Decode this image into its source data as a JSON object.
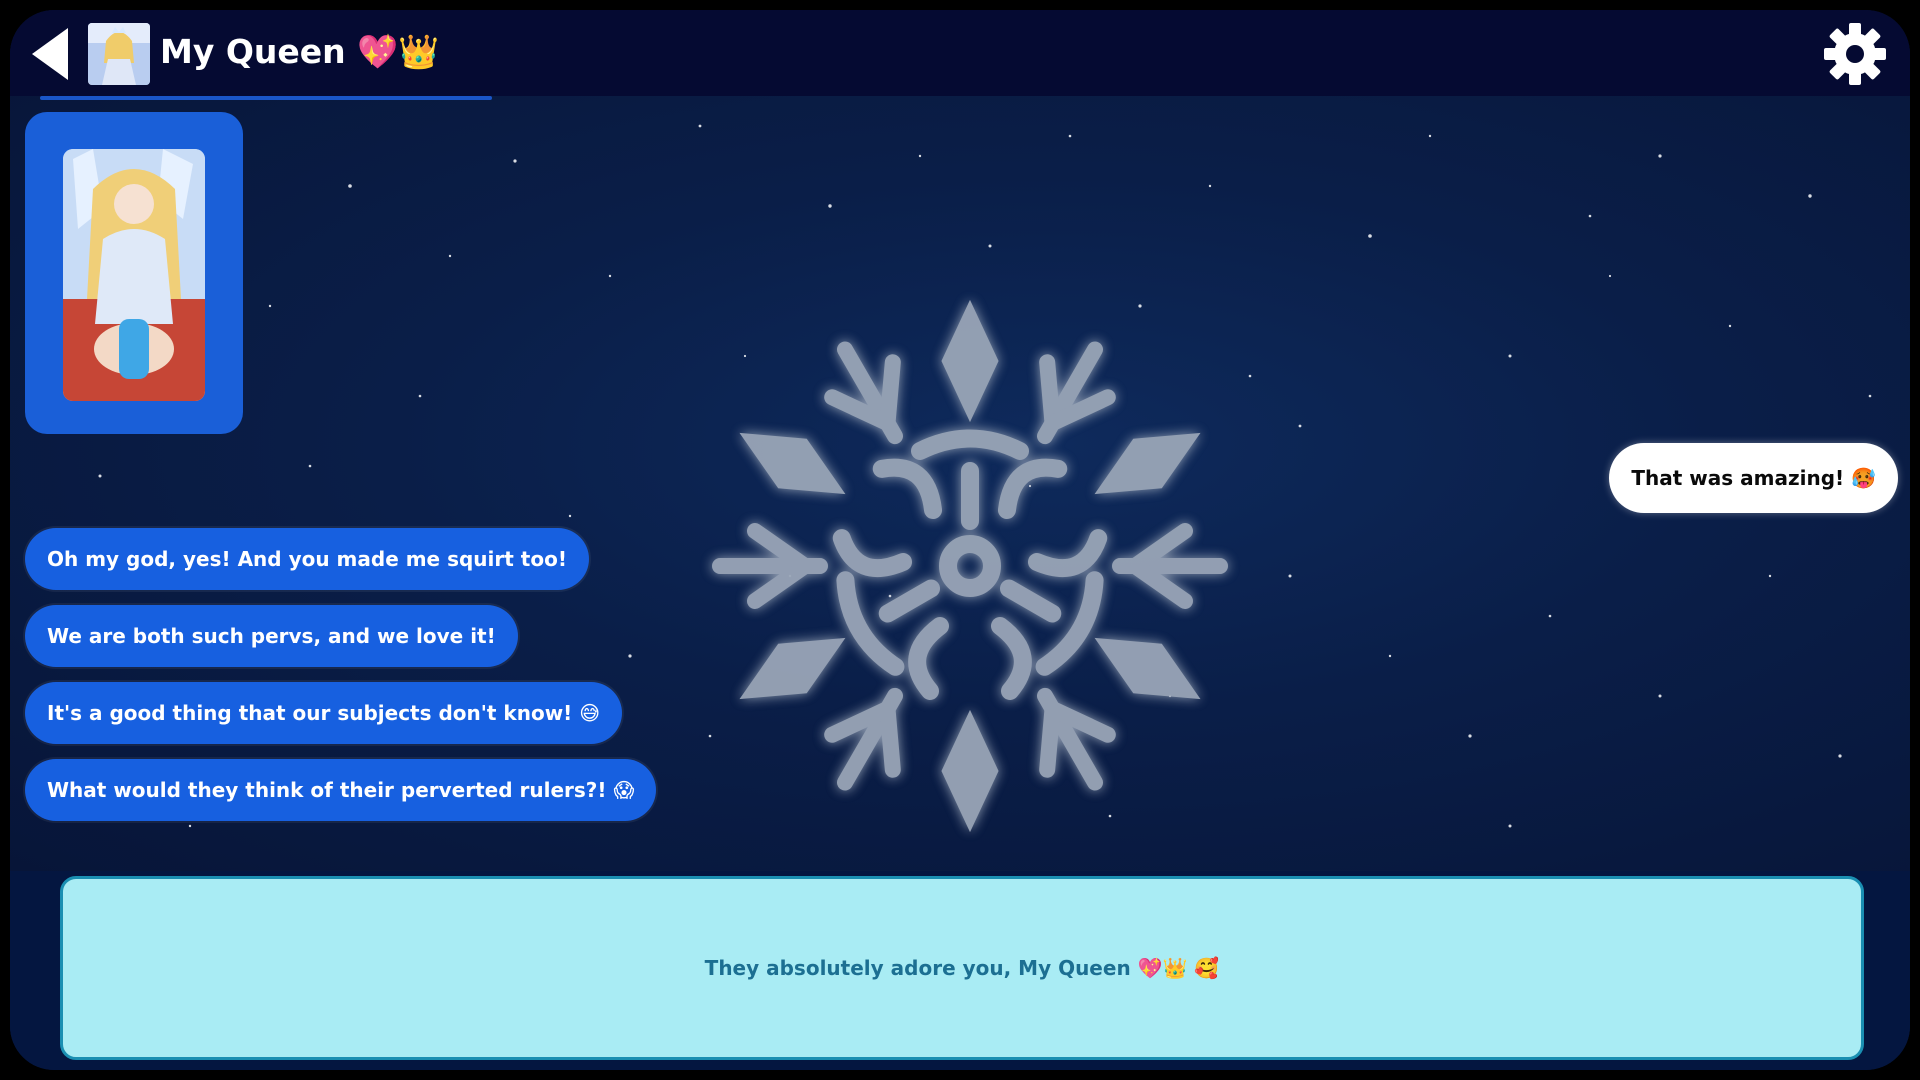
{
  "header": {
    "title": "My Queen 💖👑",
    "back_icon": "back-arrow-icon",
    "settings_icon": "gear-icon"
  },
  "chat": {
    "image_card_alt": "Queen image",
    "messages_left": [
      "Oh my god, yes! And you made me squirt too!",
      "We are both such pervs, and we love it!",
      "It's a good thing that our subjects don't know! 😅",
      "What would they think of their perverted rulers?! 😱"
    ],
    "message_right": "That was amazing! 🥵"
  },
  "reply": {
    "text": "They absolutely adore you, My Queen 💖👑 🥰"
  },
  "colors": {
    "topbar": "#050a32",
    "bubble_left": "#1760e0",
    "bubble_right": "#ffffff",
    "reply_box": "#a9ecf4",
    "reply_text": "#1c6f92"
  }
}
